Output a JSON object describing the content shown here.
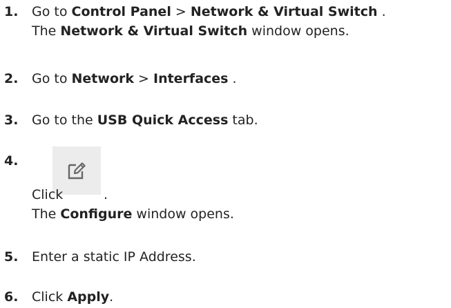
{
  "steps": [
    {
      "number": "1.",
      "line1": {
        "t1": "Go to ",
        "b1": "Control Panel",
        "t2": " > ",
        "b2": "Network & Virtual Switch",
        "t3": " ."
      },
      "line2": {
        "t1": "The ",
        "b1": "Network & Virtual Switch",
        "t2": " window opens."
      }
    },
    {
      "number": "2.",
      "line1": {
        "t1": "Go to ",
        "b1": "Network",
        "t2": " > ",
        "b2": "Interfaces",
        "t3": " ."
      }
    },
    {
      "number": "3.",
      "line1": {
        "t1": "Go to the ",
        "b1": "USB Quick Access",
        "t2": " tab."
      }
    },
    {
      "number": "4.",
      "click_text": "Click",
      "click_suffix": ".",
      "button_icon": "edit-icon",
      "line2": {
        "t1": "The ",
        "b1": "Configure",
        "t2": " window opens."
      }
    },
    {
      "number": "5.",
      "line1": {
        "t1": "Enter a static IP Address."
      }
    },
    {
      "number": "6.",
      "line1": {
        "t1": "Click ",
        "b1": "Apply",
        "t2": "."
      }
    }
  ],
  "colors": {
    "text": "#222222",
    "button_bg": "#ececec",
    "icon": "#666666"
  }
}
